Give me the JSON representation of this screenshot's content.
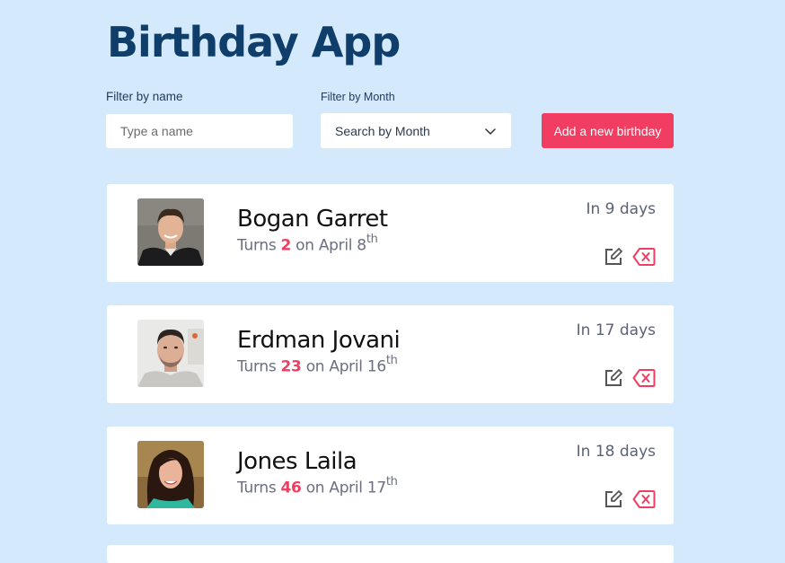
{
  "app": {
    "title": "Birthday App"
  },
  "filters": {
    "name_label": "Filter by name",
    "name_placeholder": "Type a name",
    "month_label": "Filter by Month",
    "month_selected": "Search by Month"
  },
  "actions": {
    "add_label": "Add a new birthday"
  },
  "colors": {
    "accent": "#f13d62",
    "title": "#0f3e6b",
    "background": "#d4e9fc"
  },
  "birthdays": [
    {
      "name": "Bogan Garret",
      "turns_prefix": "Turns",
      "age": "2",
      "date_text": "on April 8",
      "suffix": "th",
      "days_label": "In 9 days",
      "avatar": "avatar-photo-man-short-hair"
    },
    {
      "name": "Erdman Jovani",
      "turns_prefix": "Turns",
      "age": "23",
      "date_text": "on April 16",
      "suffix": "th",
      "days_label": "In 17 days",
      "avatar": "avatar-photo-man-beard"
    },
    {
      "name": "Jones Laila",
      "turns_prefix": "Turns",
      "age": "46",
      "date_text": "on April 17",
      "suffix": "th",
      "days_label": "In 18 days",
      "avatar": "avatar-photo-woman-long-hair"
    }
  ],
  "icons": {
    "edit": "edit-icon",
    "delete": "delete-icon",
    "dropdown": "chevron-down-icon"
  }
}
